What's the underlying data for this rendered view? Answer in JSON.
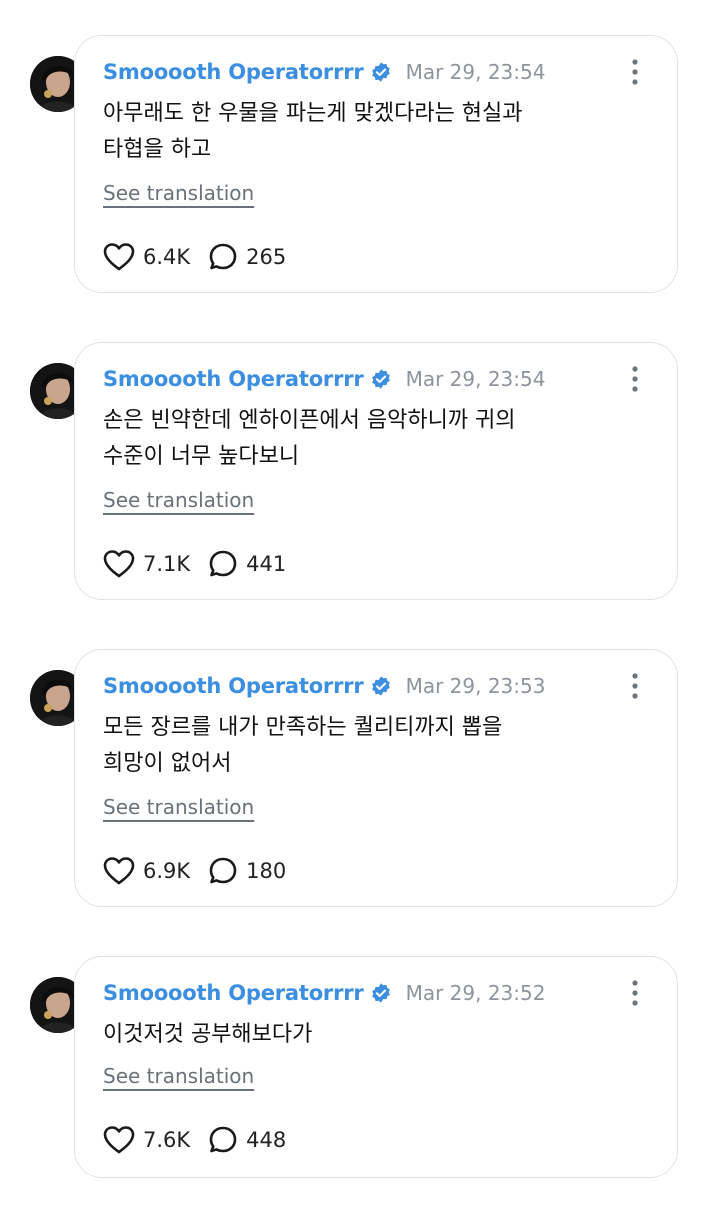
{
  "colors": {
    "author": "#3b8ee0",
    "verified_badge": "#3b8ee0",
    "timestamp": "#8e949b",
    "card_border": "#dfe3e8",
    "translation_link": "#6b7178"
  },
  "icons": {
    "verified": "verified-check-icon",
    "more": "more-vertical-icon",
    "like": "heart-icon",
    "reply": "speech-bubble-icon"
  },
  "posts": [
    {
      "author": "Smooooth Operatorrrr",
      "timestamp": "Mar 29, 23:54",
      "text_lines": [
        "아무래도 한 우물을 파는게 맞겠다라는 현실과",
        "타협을 하고"
      ],
      "translate_label": "See translation",
      "likes": "6.4K",
      "replies": "265"
    },
    {
      "author": "Smooooth Operatorrrr",
      "timestamp": "Mar 29, 23:54",
      "text_lines": [
        "손은 빈약한데 엔하이픈에서 음악하니까 귀의",
        "수준이 너무 높다보니"
      ],
      "translate_label": "See translation",
      "likes": "7.1K",
      "replies": "441"
    },
    {
      "author": "Smooooth Operatorrrr",
      "timestamp": "Mar 29, 23:53",
      "text_lines": [
        "모든 장르를 내가 만족하는 퀄리티까지 뽑을",
        "희망이 없어서"
      ],
      "translate_label": "See translation",
      "likes": "6.9K",
      "replies": "180"
    },
    {
      "author": "Smooooth Operatorrrr",
      "timestamp": "Mar 29, 23:52",
      "text_lines": [
        "이것저것 공부해보다가"
      ],
      "translate_label": "See translation",
      "likes": "7.6K",
      "replies": "448"
    }
  ]
}
